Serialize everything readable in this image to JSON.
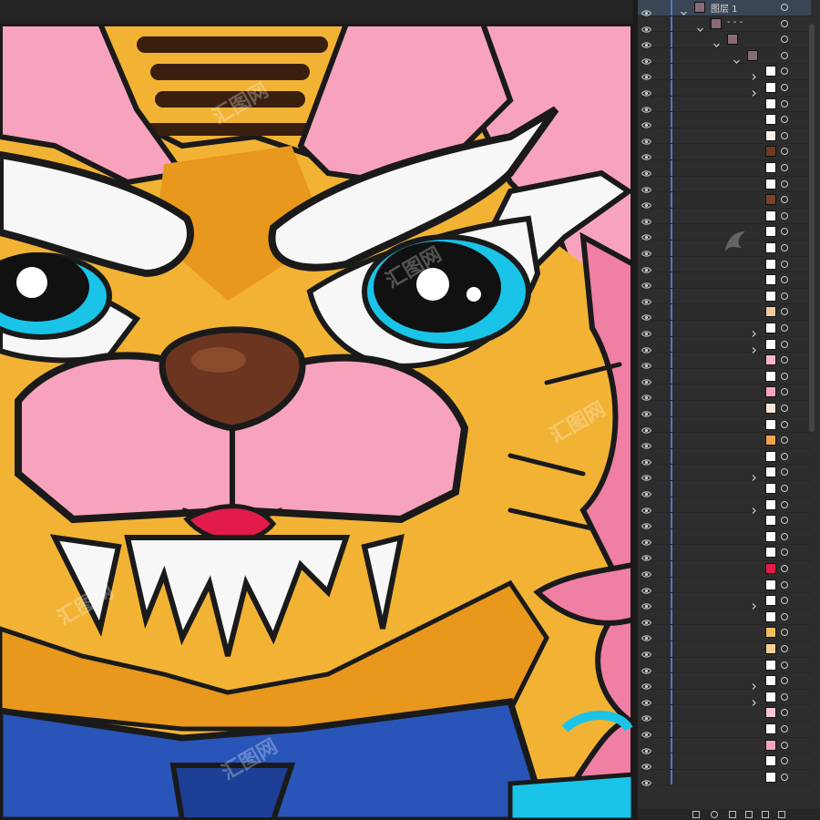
{
  "layers_panel": {
    "top_layer_label": "图层 1",
    "group_label": "- - -",
    "row_count": 49,
    "expand_rows": [
      4,
      5,
      20,
      21,
      29,
      31,
      37,
      42,
      43
    ],
    "thumb_colors": [
      "#ffffff",
      "#ffffff",
      "#ffffff",
      "#ffffff",
      "#fdf0e6",
      "#6e3b22",
      "#ffffff",
      "#ffffff",
      "#7a4228",
      "#ffffff",
      "#ffffff",
      "#ffffff",
      "#ffffff",
      "#ffffff",
      "#ffffff",
      "#f5c9a0",
      "#ffffff",
      "#ffffff",
      "#fbb6c9",
      "#ffffff",
      "#f7a8c0",
      "#fde6d6",
      "#ffffff",
      "#f0a34a",
      "#ffffff",
      "#ffffff",
      "#ffffff",
      "#ffffff",
      "#ffffff",
      "#ffffff",
      "#ffffff",
      "#e21b4a",
      "#ffffff",
      "#ffffff",
      "#ffffff",
      "#f0c060",
      "#f5d090",
      "#ffffff",
      "#ffffff",
      "#ffffff",
      "#f9c5d5",
      "#ffffff",
      "#f4a6be",
      "#ffffff",
      "#ffffff",
      "#ffffff",
      "#ffffff",
      "#ffffff",
      "#ffffff"
    ]
  },
  "watermark": {
    "text": "汇图网"
  },
  "colors": {
    "tiger_orange": "#f2b335",
    "fur_dark": "#e8981d",
    "pink": "#f7a3bd",
    "eye_blue": "#19c4e8",
    "outline": "#1a1a1a",
    "nose_brown": "#6b3520",
    "collar_blue": "#2a55b8",
    "panel_bg": "#2d2d2d",
    "selection": "#3a4656",
    "accent_line": "#4f78c4"
  }
}
